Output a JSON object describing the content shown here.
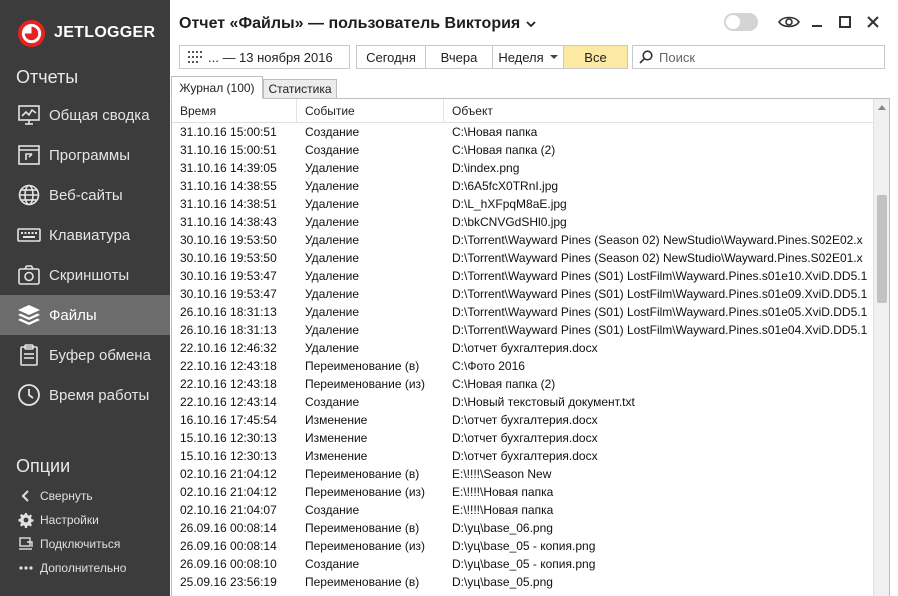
{
  "app": {
    "logo_text": "JETLOGGER"
  },
  "sidebar": {
    "reports_heading": "Отчеты",
    "items": [
      {
        "label": "Общая сводка",
        "icon": "summary-chart-icon"
      },
      {
        "label": "Программы",
        "icon": "programs-icon"
      },
      {
        "label": "Веб-сайты",
        "icon": "globe-icon"
      },
      {
        "label": "Клавиатура",
        "icon": "keyboard-icon"
      },
      {
        "label": "Скриншоты",
        "icon": "camera-icon"
      },
      {
        "label": "Файлы",
        "icon": "files-stack-icon",
        "active": true
      },
      {
        "label": "Буфер обмена",
        "icon": "clipboard-icon"
      },
      {
        "label": "Время работы",
        "icon": "clock-icon"
      }
    ],
    "options_heading": "Опции",
    "options": [
      {
        "label": "Свернуть",
        "icon": "chevron-left-icon"
      },
      {
        "label": "Настройки",
        "icon": "gear-icon"
      },
      {
        "label": "Подключиться",
        "icon": "connect-icon"
      },
      {
        "label": "Дополнительно",
        "icon": "more-dots-icon"
      }
    ]
  },
  "header": {
    "title": "Отчет «Файлы» — пользователь Виктория",
    "date_range": "... — 13 ноября 2016",
    "periods": [
      "Сегодня",
      "Вчера",
      "Неделя",
      "Все"
    ],
    "selected_period": "Все",
    "search_placeholder": "Поиск"
  },
  "tabs": [
    "Журнал (100)",
    "Статистика"
  ],
  "table": {
    "columns": [
      "Время",
      "Событие",
      "Объект"
    ],
    "rows": [
      [
        "31.10.16 15:00:51",
        "Создание",
        "C:\\Новая папка"
      ],
      [
        "31.10.16 15:00:51",
        "Создание",
        "C:\\Новая папка (2)"
      ],
      [
        "31.10.16 14:39:05",
        "Удаление",
        "D:\\index.png"
      ],
      [
        "31.10.16 14:38:55",
        "Удаление",
        "D:\\6A5fcX0TRnI.jpg"
      ],
      [
        "31.10.16 14:38:51",
        "Удаление",
        "D:\\L_hXFpqM8aE.jpg"
      ],
      [
        "31.10.16 14:38:43",
        "Удаление",
        "D:\\bkCNVGdSHl0.jpg"
      ],
      [
        "30.10.16 19:53:50",
        "Удаление",
        "D:\\Torrent\\Wayward Pines (Season 02) NewStudio\\Wayward.Pines.S02E02.x"
      ],
      [
        "30.10.16 19:53:50",
        "Удаление",
        "D:\\Torrent\\Wayward Pines (Season 02) NewStudio\\Wayward.Pines.S02E01.x"
      ],
      [
        "30.10.16 19:53:47",
        "Удаление",
        "D:\\Torrent\\Wayward Pines (S01) LostFilm\\Wayward.Pines.s01e10.XviD.DD5.1"
      ],
      [
        "30.10.16 19:53:47",
        "Удаление",
        "D:\\Torrent\\Wayward Pines (S01) LostFilm\\Wayward.Pines.s01e09.XviD.DD5.1"
      ],
      [
        "26.10.16 18:31:13",
        "Удаление",
        "D:\\Torrent\\Wayward Pines (S01) LostFilm\\Wayward.Pines.s01e05.XviD.DD5.1"
      ],
      [
        "26.10.16 18:31:13",
        "Удаление",
        "D:\\Torrent\\Wayward Pines (S01) LostFilm\\Wayward.Pines.s01e04.XviD.DD5.1"
      ],
      [
        "22.10.16 12:46:32",
        "Удаление",
        "D:\\отчет бухгалтерия.docx"
      ],
      [
        "22.10.16 12:43:18",
        "Переименование (в)",
        "C:\\Фото 2016"
      ],
      [
        "22.10.16 12:43:18",
        "Переименование (из)",
        "C:\\Новая папка (2)"
      ],
      [
        "22.10.16 12:43:14",
        "Создание",
        "D:\\Новый текстовый документ.txt"
      ],
      [
        "16.10.16 17:45:54",
        "Изменение",
        "D:\\отчет бухгалтерия.docx"
      ],
      [
        "15.10.16 12:30:13",
        "Изменение",
        "D:\\отчет бухгалтерия.docx"
      ],
      [
        "15.10.16 12:30:13",
        "Изменение",
        "D:\\отчет бухгалтерия.docx"
      ],
      [
        "02.10.16 21:04:12",
        "Переименование (в)",
        "E:\\!!!!\\Season New"
      ],
      [
        "02.10.16 21:04:12",
        "Переименование (из)",
        "E:\\!!!!\\Новая папка"
      ],
      [
        "02.10.16 21:04:07",
        "Создание",
        "E:\\!!!!\\Новая папка"
      ],
      [
        "26.09.16 00:08:14",
        "Переименование (в)",
        "D:\\yц\\base_06.png"
      ],
      [
        "26.09.16 00:08:14",
        "Переименование (из)",
        "D:\\yц\\base_05 - копия.png"
      ],
      [
        "26.09.16 00:08:10",
        "Создание",
        "D:\\yц\\base_05 - копия.png"
      ],
      [
        "25.09.16 23:56:19",
        "Переименование (в)",
        "D:\\yц\\base_05.png"
      ]
    ]
  },
  "colors": {
    "sidebar_bg": "#3c3c3c",
    "sidebar_active": "#6c6c6c",
    "logo_red": "#e52420",
    "selected_period_bg": "#fce9a3"
  }
}
